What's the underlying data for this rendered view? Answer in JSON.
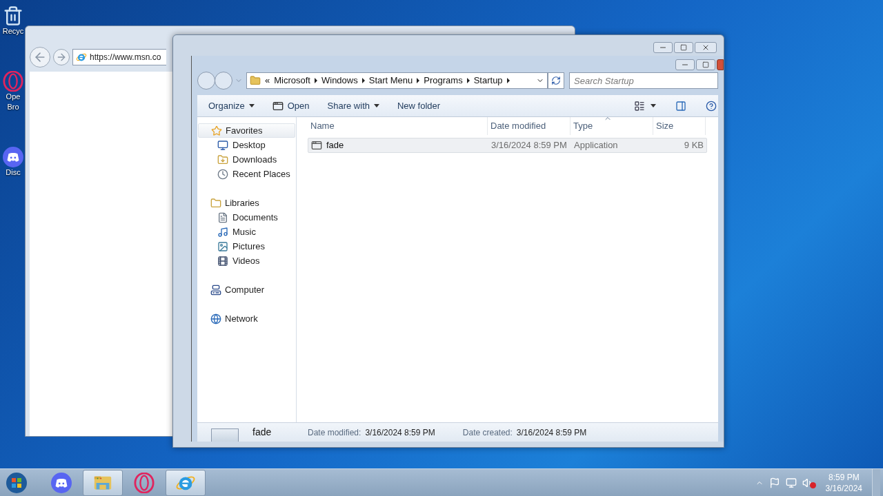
{
  "desktop_icons": [
    {
      "kind": "recycle",
      "label_lines": [
        "Recyc"
      ]
    },
    {
      "kind": "opera",
      "label_lines": [
        "Ope",
        "Bro"
      ]
    },
    {
      "kind": "discord",
      "label_lines": [
        "Disc"
      ]
    }
  ],
  "browser": {
    "address": "https://www.msn.co"
  },
  "explorer": {
    "overflow": "«",
    "breadcrumb": [
      "Microsoft",
      "Windows",
      "Start Menu",
      "Programs",
      "Startup"
    ],
    "search_placeholder": "Search Startup",
    "toolbar": [
      {
        "label": "Organize",
        "kind": "menu"
      },
      {
        "label": "Open",
        "kind": "icon"
      },
      {
        "label": "Share with",
        "kind": "menu"
      },
      {
        "label": "New folder",
        "kind": "plain"
      }
    ],
    "nav": [
      {
        "label": "Favorites",
        "kind": "star",
        "children": [
          {
            "label": "Desktop",
            "kind": "desktop"
          },
          {
            "label": "Downloads",
            "kind": "downloads"
          },
          {
            "label": "Recent Places",
            "kind": "recent"
          }
        ]
      },
      {
        "label": "Libraries",
        "kind": "folder",
        "children": [
          {
            "label": "Documents",
            "kind": "document"
          },
          {
            "label": "Music",
            "kind": "music"
          },
          {
            "label": "Pictures",
            "kind": "pictures"
          },
          {
            "label": "Videos",
            "kind": "videos"
          }
        ]
      },
      {
        "label": "Computer",
        "kind": "computer"
      },
      {
        "label": "Network",
        "kind": "network"
      }
    ],
    "columns": [
      {
        "label": "Name",
        "sorted": false
      },
      {
        "label": "Date modified",
        "sorted": false
      },
      {
        "label": "Type",
        "sorted": true
      },
      {
        "label": "Size",
        "sorted": false
      }
    ],
    "files": [
      {
        "name": "fade",
        "date": "3/16/2024 8:59 PM",
        "type": "Application",
        "size": "9 KB",
        "selected": true
      }
    ],
    "details": {
      "name": "fade",
      "fields": [
        {
          "label": "Date modified:",
          "value": "3/16/2024 8:59 PM"
        },
        {
          "label": "Date created:",
          "value": "3/16/2024 8:59 PM"
        }
      ]
    }
  },
  "taskbar": {
    "apps": [
      {
        "kind": "discord",
        "active": false
      },
      {
        "kind": "explorer",
        "active": true
      },
      {
        "kind": "opera",
        "active": false
      },
      {
        "kind": "ie",
        "active": true
      }
    ],
    "time": "8:59 PM",
    "date": "3/16/2024"
  }
}
